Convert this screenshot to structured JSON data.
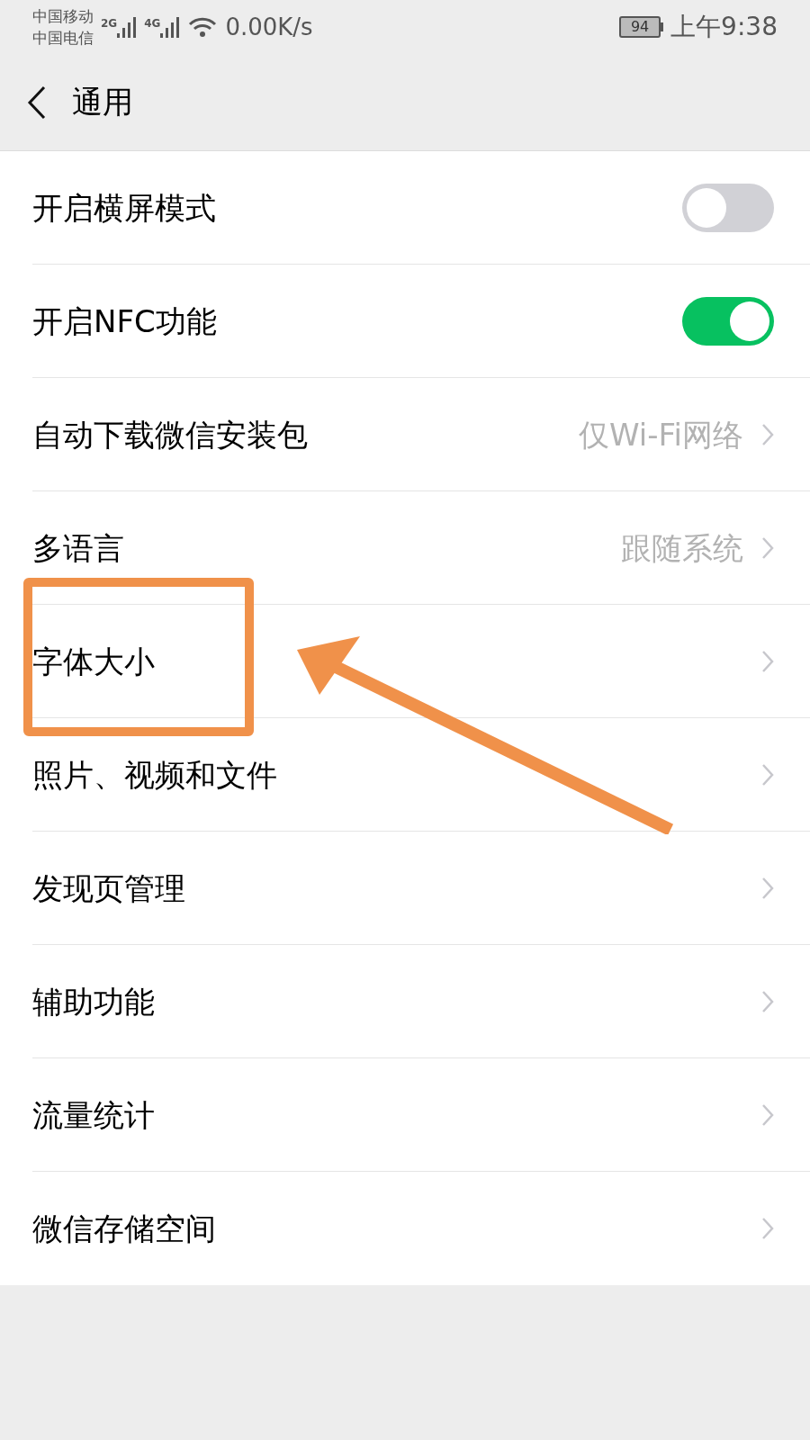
{
  "status_bar": {
    "carriers": [
      "中国移动",
      "中国电信"
    ],
    "signals": [
      {
        "label": "2G"
      },
      {
        "label": "4G"
      }
    ],
    "speed": "0.00K/s",
    "battery": "94",
    "time": "上午9:38"
  },
  "header": {
    "title": "通用"
  },
  "items": [
    {
      "kind": "toggle",
      "label": "开启横屏模式",
      "on": false
    },
    {
      "kind": "toggle",
      "label": "开启NFC功能",
      "on": true
    },
    {
      "kind": "value",
      "label": "自动下载微信安装包",
      "value": "仅Wi-Fi网络"
    },
    {
      "kind": "value",
      "label": "多语言",
      "value": "跟随系统"
    },
    {
      "kind": "plain",
      "label": "字体大小",
      "highlighted": true
    },
    {
      "kind": "plain",
      "label": "照片、视频和文件"
    },
    {
      "kind": "plain",
      "label": "发现页管理"
    },
    {
      "kind": "plain",
      "label": "辅助功能"
    },
    {
      "kind": "plain",
      "label": "流量统计"
    },
    {
      "kind": "plain",
      "label": "微信存储空间"
    }
  ]
}
